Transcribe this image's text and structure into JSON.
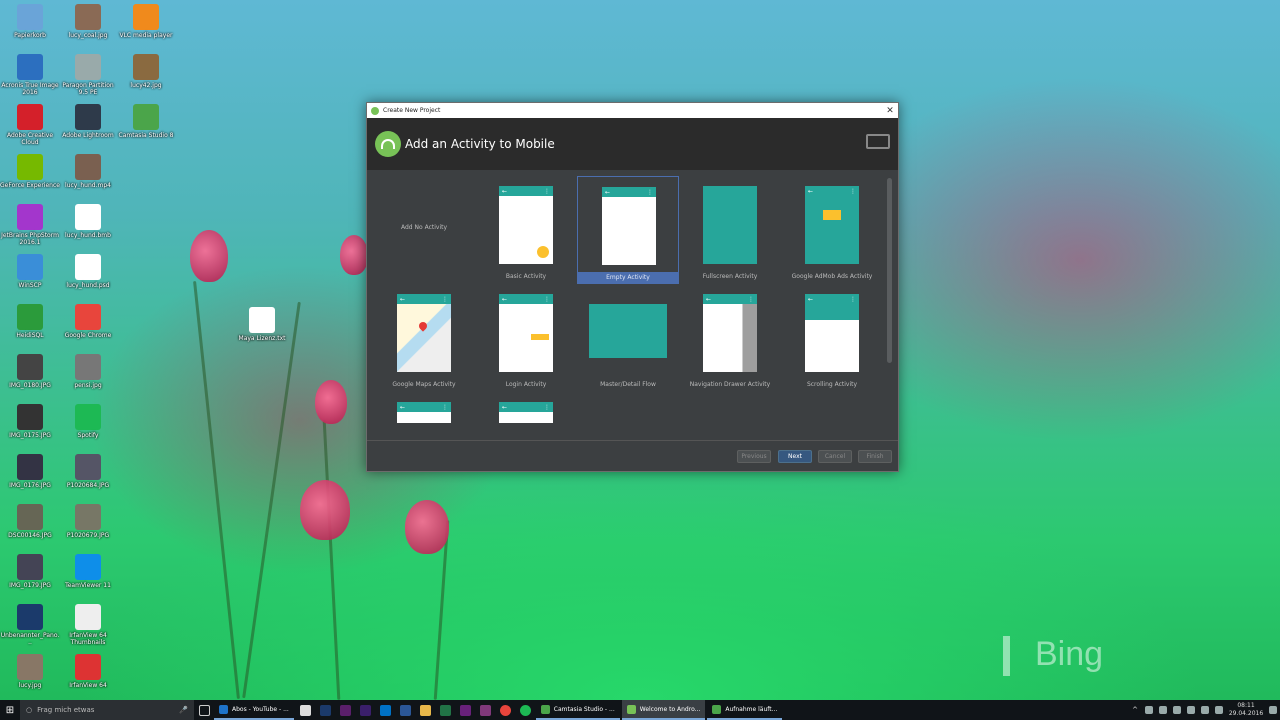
{
  "desktop_icons": [
    {
      "label": "Papierkorb",
      "glyph": "recycle-bin-icon",
      "color": "#6aa4d8"
    },
    {
      "label": "lucy_coal.jpg",
      "glyph": "image-icon",
      "color": "#8a6a55"
    },
    {
      "label": "VLC media player",
      "glyph": "vlc-icon",
      "color": "#f08a1c"
    },
    {
      "label": "Acronis True Image 2016",
      "glyph": "acronis-icon",
      "color": "#2c6fbf"
    },
    {
      "label": "Paragon Partition 9.5 PE",
      "glyph": "paragon-icon",
      "color": "#9aa"
    },
    {
      "label": "lucy42.jpg",
      "glyph": "image-icon",
      "color": "#8a6a40"
    },
    {
      "label": "Adobe Creative Cloud",
      "glyph": "creative-cloud-icon",
      "color": "#d4202a"
    },
    {
      "label": "Adobe Lightroom",
      "glyph": "lightroom-icon",
      "color": "#2e3a4a"
    },
    {
      "label": "Camtasia Studio 8",
      "glyph": "camtasia-icon",
      "color": "#4ba54a"
    },
    {
      "label": "GeForce Experience",
      "glyph": "nvidia-icon",
      "color": "#76b900"
    },
    {
      "label": "lucy_hund.mp4",
      "glyph": "video-icon",
      "color": "#7a6050"
    },
    {
      "label": "JetBrains PhpStorm 2016.1",
      "glyph": "phpstorm-icon",
      "color": "#a336cc"
    },
    {
      "label": "lucy_hund.bmb",
      "glyph": "file-icon",
      "color": "#ffffff"
    },
    {
      "label": "WinSCP",
      "glyph": "winscp-icon",
      "color": "#3a8ed8"
    },
    {
      "label": "lucy_hund.psd",
      "glyph": "file-icon",
      "color": "#ffffff"
    },
    {
      "label": "HeidiSQL",
      "glyph": "heidisql-icon",
      "color": "#2b9b3b"
    },
    {
      "label": "Google Chrome",
      "glyph": "chrome-icon",
      "color": "#e8453c"
    },
    {
      "label": "IMG_0180.JPG",
      "glyph": "image-icon",
      "color": "#444"
    },
    {
      "label": "pensi.jpg",
      "glyph": "image-icon",
      "color": "#777"
    },
    {
      "label": "IMG_0175.JPG",
      "glyph": "image-icon",
      "color": "#333"
    },
    {
      "label": "Spotify",
      "glyph": "spotify-icon",
      "color": "#1db954"
    },
    {
      "label": "IMG_0176.JPG",
      "glyph": "image-icon",
      "color": "#334"
    },
    {
      "label": "P1020684.JPG",
      "glyph": "image-icon",
      "color": "#556"
    },
    {
      "label": "DSC00146.JPG",
      "glyph": "image-icon",
      "color": "#665"
    },
    {
      "label": "P1020679.JPG",
      "glyph": "image-icon",
      "color": "#776"
    },
    {
      "label": "IMG_0179.JPG",
      "glyph": "image-icon",
      "color": "#445"
    },
    {
      "label": "TeamViewer 11",
      "glyph": "teamviewer-icon",
      "color": "#0e8ee9"
    },
    {
      "label": "Unbenannter_Pano...",
      "glyph": "photoshop-icon",
      "color": "#1b3a6b"
    },
    {
      "label": "IrfanView 64 Thumbnails",
      "glyph": "irfanview-icon",
      "color": "#eee"
    },
    {
      "label": "lucy.jpg",
      "glyph": "image-icon",
      "color": "#876"
    },
    {
      "label": "IrfanView 64",
      "glyph": "irfanview-icon",
      "color": "#d33"
    },
    {
      "label": "Maya Lizenz.txt",
      "glyph": "file-icon",
      "color": "#ffffff"
    }
  ],
  "dialog": {
    "window_title": "Create New Project",
    "heading": "Add an Activity to Mobile",
    "activities": [
      {
        "label": "Add No Activity",
        "kind": "none"
      },
      {
        "label": "Basic Activity",
        "kind": "basic"
      },
      {
        "label": "Empty Activity",
        "kind": "empty",
        "selected": true
      },
      {
        "label": "Fullscreen Activity",
        "kind": "fullscreen"
      },
      {
        "label": "Google AdMob Ads Activity",
        "kind": "admob"
      },
      {
        "label": "Google Maps Activity",
        "kind": "maps"
      },
      {
        "label": "Login Activity",
        "kind": "login"
      },
      {
        "label": "Master/Detail Flow",
        "kind": "masterdetail"
      },
      {
        "label": "Navigation Drawer Activity",
        "kind": "navdrawer"
      },
      {
        "label": "Scrolling Activity",
        "kind": "scrolling"
      }
    ],
    "buttons": {
      "previous": "Previous",
      "next": "Next",
      "cancel": "Cancel",
      "finish": "Finish"
    }
  },
  "taskbar": {
    "search_placeholder": "Frag mich etwas",
    "apps": [
      {
        "label": "Abos - YouTube - ...",
        "color": "#1e73c9"
      },
      {
        "label": "Camtasia Studio - ...",
        "color": "#4ba54a"
      },
      {
        "label": "Welcome to Andro...",
        "color": "#78c257",
        "active": true
      },
      {
        "label": "Aufnahme läuft...",
        "color": "#4ba54a"
      }
    ],
    "clock_time": "08:11",
    "clock_date": "29.04.2016"
  },
  "wallpaper_brand": "Bing"
}
